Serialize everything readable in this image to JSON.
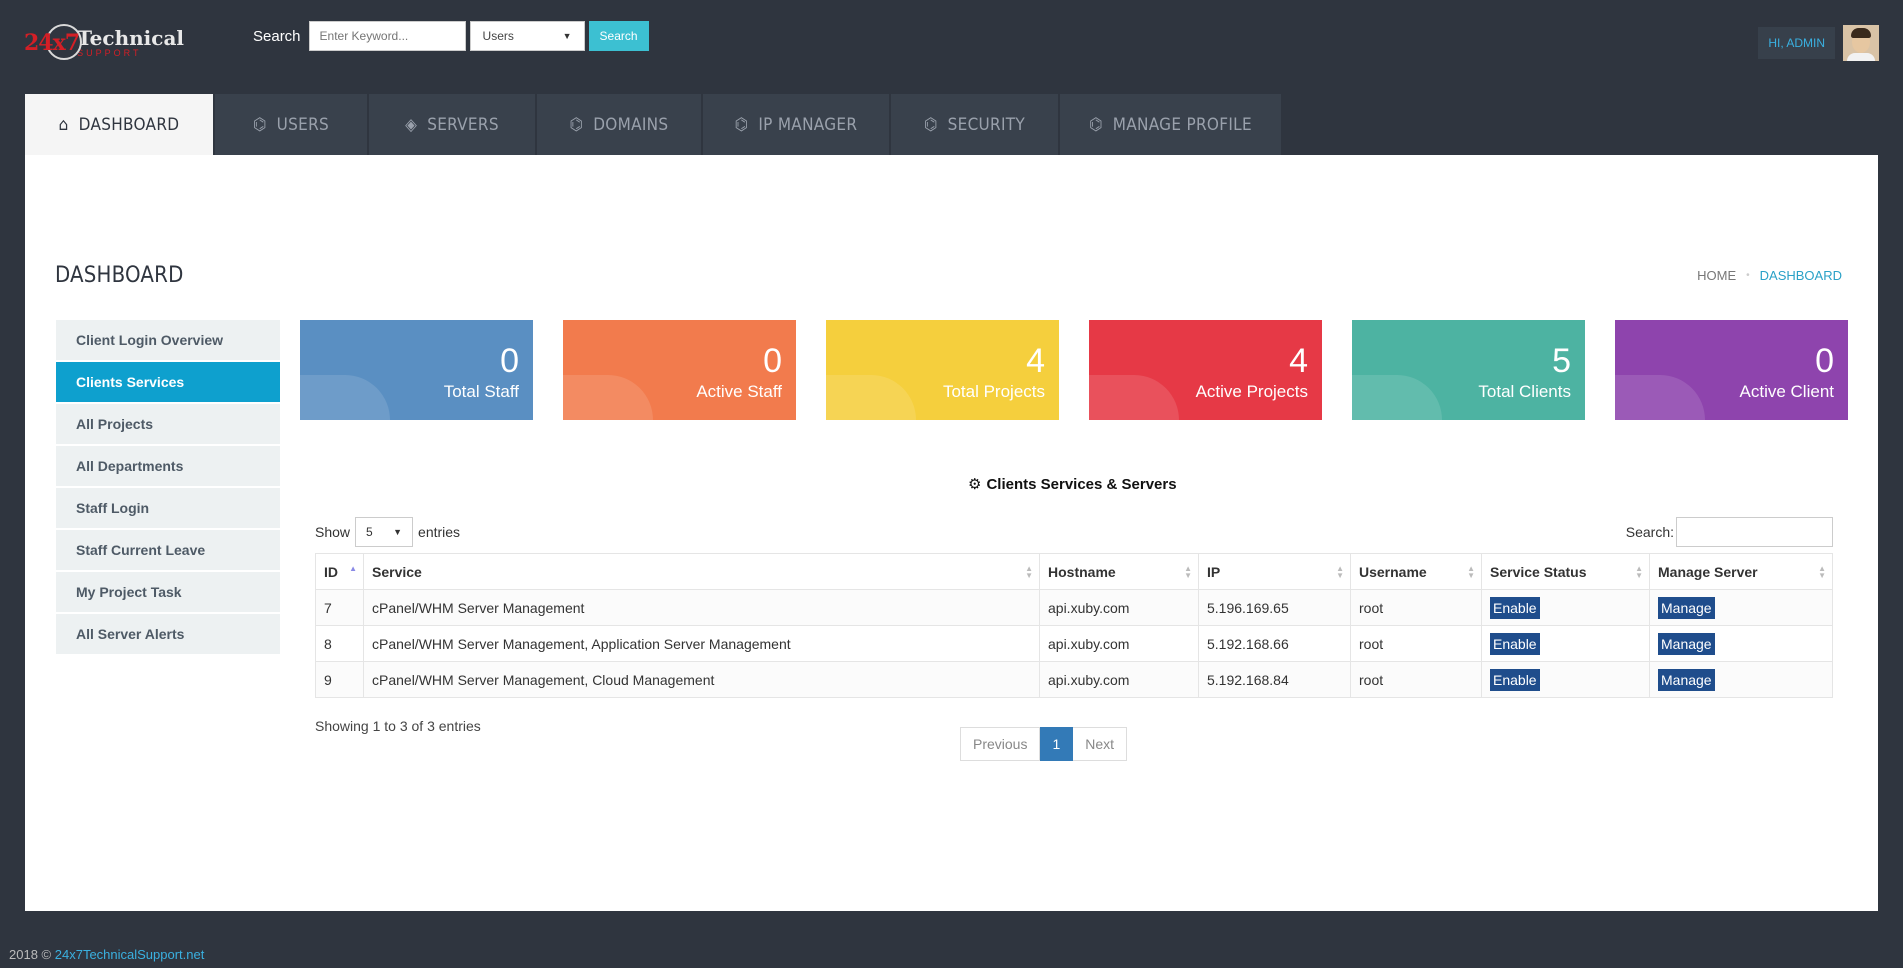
{
  "header": {
    "logo_num": "24x7",
    "logo_title": "Technical",
    "logo_sub": "SUPPORT",
    "search_label": "Search",
    "search_placeholder": "Enter Keyword...",
    "search_scope": "Users",
    "search_button": "Search",
    "greeting": "HI, ADMIN"
  },
  "nav": {
    "tabs": [
      {
        "label": "DASHBOARD",
        "icon": "home-icon",
        "glyph": "⌂"
      },
      {
        "label": "USERS",
        "icon": "tag-icon",
        "glyph": "⌬"
      },
      {
        "label": "SERVERS",
        "icon": "layers-icon",
        "glyph": "◈"
      },
      {
        "label": "DOMAINS",
        "icon": "tag-icon",
        "glyph": "⌬"
      },
      {
        "label": "IP MANAGER",
        "icon": "tag-icon",
        "glyph": "⌬"
      },
      {
        "label": "SECURITY",
        "icon": "tag-icon",
        "glyph": "⌬"
      },
      {
        "label": "MANAGE PROFILE",
        "icon": "tag-icon",
        "glyph": "⌬"
      }
    ]
  },
  "page": {
    "title": "DASHBOARD",
    "breadcrumb_home": "HOME",
    "breadcrumb_sep": "•",
    "breadcrumb_current": "DASHBOARD"
  },
  "sidebar": {
    "items": [
      {
        "label": "Client Login Overview"
      },
      {
        "label": "Clients Services"
      },
      {
        "label": "All Projects"
      },
      {
        "label": "All Departments"
      },
      {
        "label": "Staff Login"
      },
      {
        "label": "Staff Current Leave"
      },
      {
        "label": "My Project Task"
      },
      {
        "label": "All Server Alerts"
      }
    ]
  },
  "cards": [
    {
      "value": "0",
      "label": "Total Staff",
      "color": "#5a8fc2"
    },
    {
      "value": "0",
      "label": "Active Staff",
      "color": "#f27b4d"
    },
    {
      "value": "4",
      "label": "Total Projects",
      "color": "#f5cf3d"
    },
    {
      "value": "4",
      "label": "Active Projects",
      "color": "#e63946"
    },
    {
      "value": "5",
      "label": "Total Clients",
      "color": "#4db3a2"
    },
    {
      "value": "0",
      "label": "Active Client",
      "color": "#8e44ad"
    }
  ],
  "table_section": {
    "title": "Clients Services & Servers",
    "show_label": "Show",
    "entries_value": "5",
    "entries_label": "entries",
    "search_label": "Search:",
    "columns": [
      "ID",
      "Service",
      "Hostname",
      "IP",
      "Username",
      "Service Status",
      "Manage Server"
    ],
    "rows": [
      {
        "id": "7",
        "service": "cPanel/WHM Server Management",
        "hostname": "api.xuby.com",
        "ip": "5.196.169.65",
        "username": "root",
        "status": "Enable",
        "manage": "Manage"
      },
      {
        "id": "8",
        "service": "cPanel/WHM Server Management, Application Server Management",
        "hostname": "api.xuby.com",
        "ip": "5.192.168.66",
        "username": "root",
        "status": "Enable",
        "manage": "Manage"
      },
      {
        "id": "9",
        "service": "cPanel/WHM Server Management, Cloud Management",
        "hostname": "api.xuby.com",
        "ip": "5.192.168.84",
        "username": "root",
        "status": "Enable",
        "manage": "Manage"
      }
    ],
    "showing_text": "Showing 1 to 3 of 3 entries",
    "pager": {
      "prev": "Previous",
      "current": "1",
      "next": "Next"
    }
  },
  "footer": {
    "copyright": "2018 ©",
    "link": "24x7TechnicalSupport.net"
  }
}
